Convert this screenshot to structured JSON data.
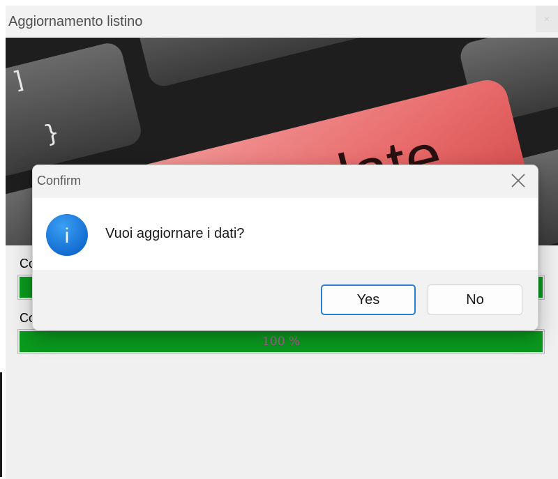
{
  "main_window": {
    "title": "Aggiornamento listino",
    "close_glyph": "×",
    "banner": {
      "key_label": "Update"
    },
    "labels": {
      "first_partial": "Co",
      "second_partial": "Co"
    },
    "progress": [
      {
        "fraction": 1.0,
        "text": ""
      },
      {
        "fraction": 1.0,
        "text": "100 %"
      }
    ]
  },
  "dialog": {
    "title": "Confirm",
    "close_glyph": "✕",
    "icon": "info-icon",
    "icon_glyph": "i",
    "message": "Vuoi aggiornare i dati?",
    "buttons": {
      "yes": "Yes",
      "no": "No"
    }
  },
  "colors": {
    "progress_fill": "#0a9a1e",
    "progress_text": "#b5589a",
    "info_icon": "#1f7fe0",
    "primary_button_border": "#2a7fcf",
    "update_key": "#e25555"
  }
}
